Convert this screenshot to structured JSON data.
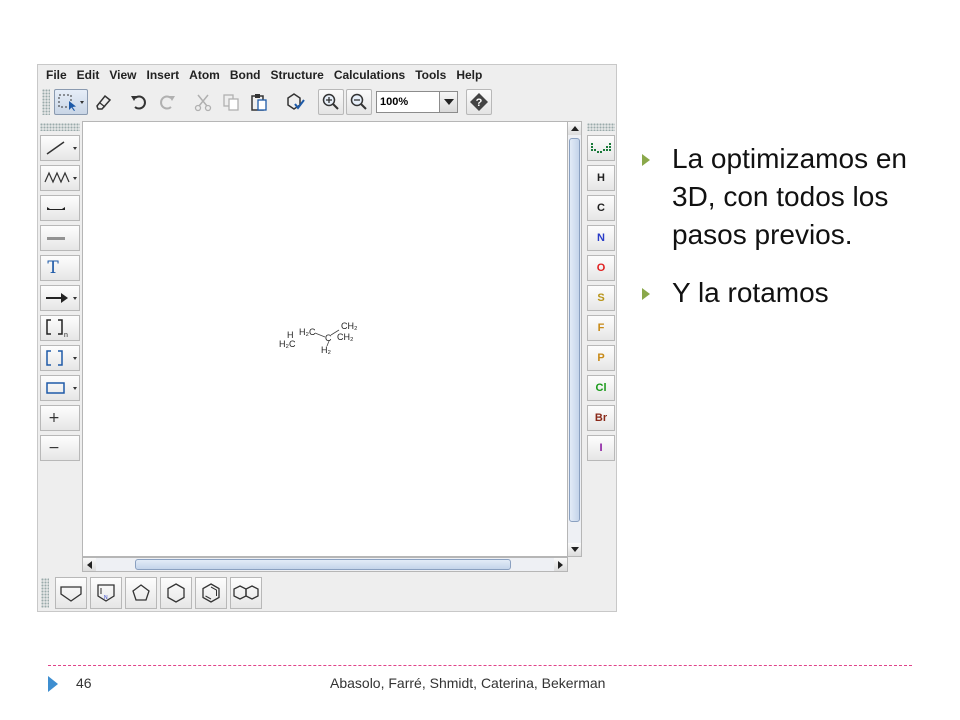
{
  "app": {
    "menu": [
      {
        "label": "File"
      },
      {
        "label": "Edit"
      },
      {
        "label": "View"
      },
      {
        "label": "Insert"
      },
      {
        "label": "Atom"
      },
      {
        "label": "Bond"
      },
      {
        "label": "Structure"
      },
      {
        "label": "Calculations"
      },
      {
        "label": "Tools"
      },
      {
        "label": "Help"
      }
    ],
    "toolbar": {
      "icons": [
        "select-icon",
        "eraser-icon",
        "undo-icon",
        "redo-icon",
        "cut-icon",
        "copy-icon",
        "paste-icon",
        "clean-structure-icon",
        "zoom-in-icon",
        "zoom-out-icon",
        "help-icon"
      ],
      "zoom_value": "100%"
    },
    "left_tools": {
      "icons": [
        "single-bond-icon",
        "chain-icon",
        "bold-bond-icon",
        "hashed-bond-icon",
        "text-icon",
        "reaction-arrow-icon",
        "group-bracket-icon",
        "bracket-icon",
        "rectangle-icon",
        "plus-icon",
        "minus-icon"
      ],
      "text_tool_label": "T",
      "plus_label": "+",
      "minus_label": "−"
    },
    "elements": [
      {
        "symbol": "H",
        "color": "#222222"
      },
      {
        "symbol": "C",
        "color": "#222222"
      },
      {
        "symbol": "N",
        "color": "#2a3cc8"
      },
      {
        "symbol": "O",
        "color": "#e02020"
      },
      {
        "symbol": "S",
        "color": "#b89418"
      },
      {
        "symbol": "F",
        "color": "#c88a18"
      },
      {
        "symbol": "P",
        "color": "#c88a18"
      },
      {
        "symbol": "Cl",
        "color": "#1a9a1a"
      },
      {
        "symbol": "Br",
        "color": "#8a2a1a"
      },
      {
        "symbol": "I",
        "color": "#8a1aa0"
      }
    ],
    "templates": [
      "cyclopentane-template-icon",
      "pyrrole-template-icon",
      "pentagon-template-icon",
      "hexagon-template-icon",
      "benzene-template-icon",
      "naphthalene-template-icon"
    ],
    "molecule": {
      "labels": [
        "H",
        "H₂C",
        "H₂C",
        "C",
        "CH₂",
        "CH₂",
        "H₂"
      ]
    }
  },
  "slide": {
    "bullets": [
      "La optimizamos en 3D, con todos los pasos previos.",
      "Y la rotamos"
    ],
    "accent_color": "#8aa84a",
    "footer": {
      "page_number": "46",
      "authors": "Abasolo, Farré, Shmidt, Caterina, Bekerman"
    }
  }
}
